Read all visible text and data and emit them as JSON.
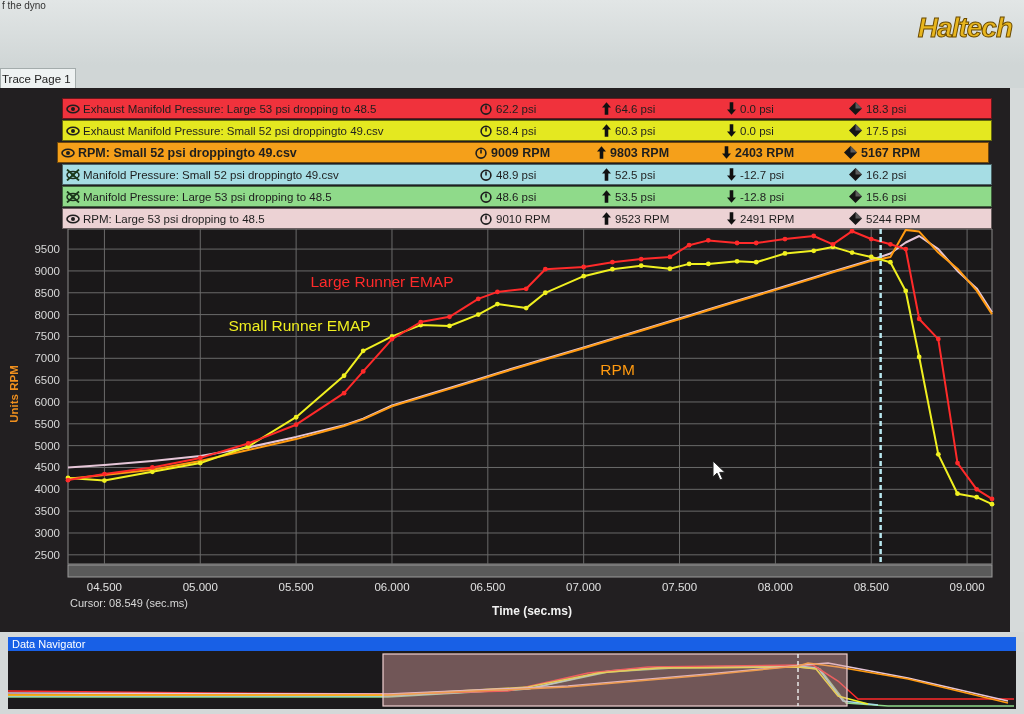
{
  "header": {
    "caption": "f the dyno",
    "logo": "Haltech"
  },
  "tabs": [
    {
      "label": "Trace Page 1",
      "selected": true
    }
  ],
  "legend": {
    "rows": [
      {
        "name": "Exhaust Manifold Pressure: Large 53 psi dropping to 48.5",
        "color": "#f0323c",
        "visible": true,
        "selected": false,
        "current": "62.2 psi",
        "max": "64.6 psi",
        "min": "0.0 psi",
        "average": "18.3 psi"
      },
      {
        "name": "Exhaust Manifold Pressure: Small 52 psi droppingto 49.csv",
        "color": "#e4e820",
        "visible": true,
        "selected": false,
        "current": "58.4 psi",
        "max": "60.3 psi",
        "min": "0.0 psi",
        "average": "17.5 psi"
      },
      {
        "name": "RPM: Small 52 psi droppingto 49.csv",
        "color": "#f5a01a",
        "visible": true,
        "selected": true,
        "current": "9009 RPM",
        "max": "9803 RPM",
        "min": "2403 RPM",
        "average": "5167 RPM"
      },
      {
        "name": "Manifold Pressure: Small 52 psi droppingto 49.csv",
        "color": "#a6dde4",
        "visible": false,
        "selected": false,
        "current": "48.9 psi",
        "max": "52.5 psi",
        "min": "-12.7 psi",
        "average": "16.2 psi"
      },
      {
        "name": "Manifold Pressure: Large 53 psi dropping to 48.5",
        "color": "#8fda8a",
        "visible": false,
        "selected": false,
        "current": "48.6 psi",
        "max": "53.5 psi",
        "min": "-12.8 psi",
        "average": "15.6 psi"
      },
      {
        "name": "RPM: Large 53 psi dropping to 48.5",
        "color": "#ecd2d4",
        "visible": true,
        "selected": false,
        "current": "9010 RPM",
        "max": "9523 RPM",
        "min": "2491 RPM",
        "average": "5244 RPM"
      }
    ]
  },
  "chart": {
    "chart_data": {
      "type": "line",
      "xlabel": "Time (sec.ms)",
      "ylabel": "Units RPM",
      "grid": true,
      "xlim": [
        4.31,
        9.13
      ],
      "ylim": [
        2290,
        9960
      ],
      "xticks": [
        {
          "value": 4.5,
          "label": "04.500"
        },
        {
          "value": 5.0,
          "label": "05.000"
        },
        {
          "value": 5.5,
          "label": "05.500"
        },
        {
          "value": 6.0,
          "label": "06.000"
        },
        {
          "value": 6.5,
          "label": "06.500"
        },
        {
          "value": 7.0,
          "label": "07.000"
        },
        {
          "value": 7.5,
          "label": "07.500"
        },
        {
          "value": 8.0,
          "label": "08.000"
        },
        {
          "value": 8.5,
          "label": "08.500"
        },
        {
          "value": 9.0,
          "label": "09.000"
        }
      ],
      "yticks": [
        2500,
        3000,
        3500,
        4000,
        4500,
        5000,
        5500,
        6000,
        6500,
        7000,
        7500,
        8000,
        8500,
        9000,
        9500
      ],
      "x": [
        4.31,
        4.5,
        4.75,
        5.0,
        5.25,
        5.5,
        5.75,
        5.85,
        6.0,
        6.15,
        6.3,
        6.45,
        6.55,
        6.7,
        6.8,
        7.0,
        7.15,
        7.3,
        7.45,
        7.55,
        7.65,
        7.8,
        7.9,
        8.05,
        8.2,
        8.3,
        8.4,
        8.5,
        8.6,
        8.68,
        8.75,
        8.85,
        8.95,
        9.05,
        9.13
      ],
      "series": [
        {
          "color": "#e6c6d8",
          "values": [
            4500,
            4560,
            4650,
            4760,
            4960,
            5200,
            5470,
            5620,
            5920,
            6120,
            6320,
            6520,
            6660,
            6860,
            6990,
            7250,
            7450,
            7650,
            7850,
            7980,
            8120,
            8320,
            8450,
            8650,
            8850,
            8990,
            9120,
            9250,
            9400,
            9650,
            9800,
            9500,
            9000,
            8600,
            8050
          ]
        },
        {
          "color": "#ff9a10",
          "values": [
            4240,
            4330,
            4450,
            4650,
            4900,
            5150,
            5450,
            5600,
            5900,
            6100,
            6300,
            6500,
            6640,
            6840,
            6970,
            7230,
            7430,
            7630,
            7830,
            7960,
            8100,
            8300,
            8430,
            8630,
            8830,
            8970,
            9100,
            9230,
            9320,
            9940,
            9900,
            9420,
            9050,
            8550,
            8010
          ]
        },
        {
          "color": "#f0f020",
          "values": [
            4260,
            4200,
            4400,
            4600,
            4980,
            5650,
            6600,
            7170,
            7500,
            7760,
            7740,
            8000,
            8240,
            8150,
            8500,
            8880,
            9040,
            9120,
            9050,
            9160,
            9160,
            9220,
            9200,
            9400,
            9460,
            9550,
            9420,
            9320,
            9200,
            8540,
            7030,
            4800,
            3900,
            3820,
            3660
          ]
        },
        {
          "color": "#ff2a2a",
          "values": [
            4210,
            4350,
            4500,
            4720,
            5050,
            5480,
            6200,
            6700,
            7440,
            7830,
            7950,
            8360,
            8520,
            8590,
            9040,
            9090,
            9200,
            9270,
            9320,
            9590,
            9700,
            9640,
            9640,
            9730,
            9800,
            9610,
            9910,
            9730,
            9610,
            9500,
            7900,
            7440,
            4600,
            4000,
            3780
          ]
        }
      ],
      "ref_lines": [
        {
          "axis": "x",
          "value": 8.549
        }
      ],
      "annotations": [
        "Large Runner EMAP",
        "Small Runner EMAP",
        "RPM"
      ]
    },
    "series_markers": [
      false,
      false,
      true,
      true
    ],
    "cursor_label": "Cursor: 08.549 (sec.ms)"
  },
  "navigator": {
    "title": "Data Navigator"
  }
}
